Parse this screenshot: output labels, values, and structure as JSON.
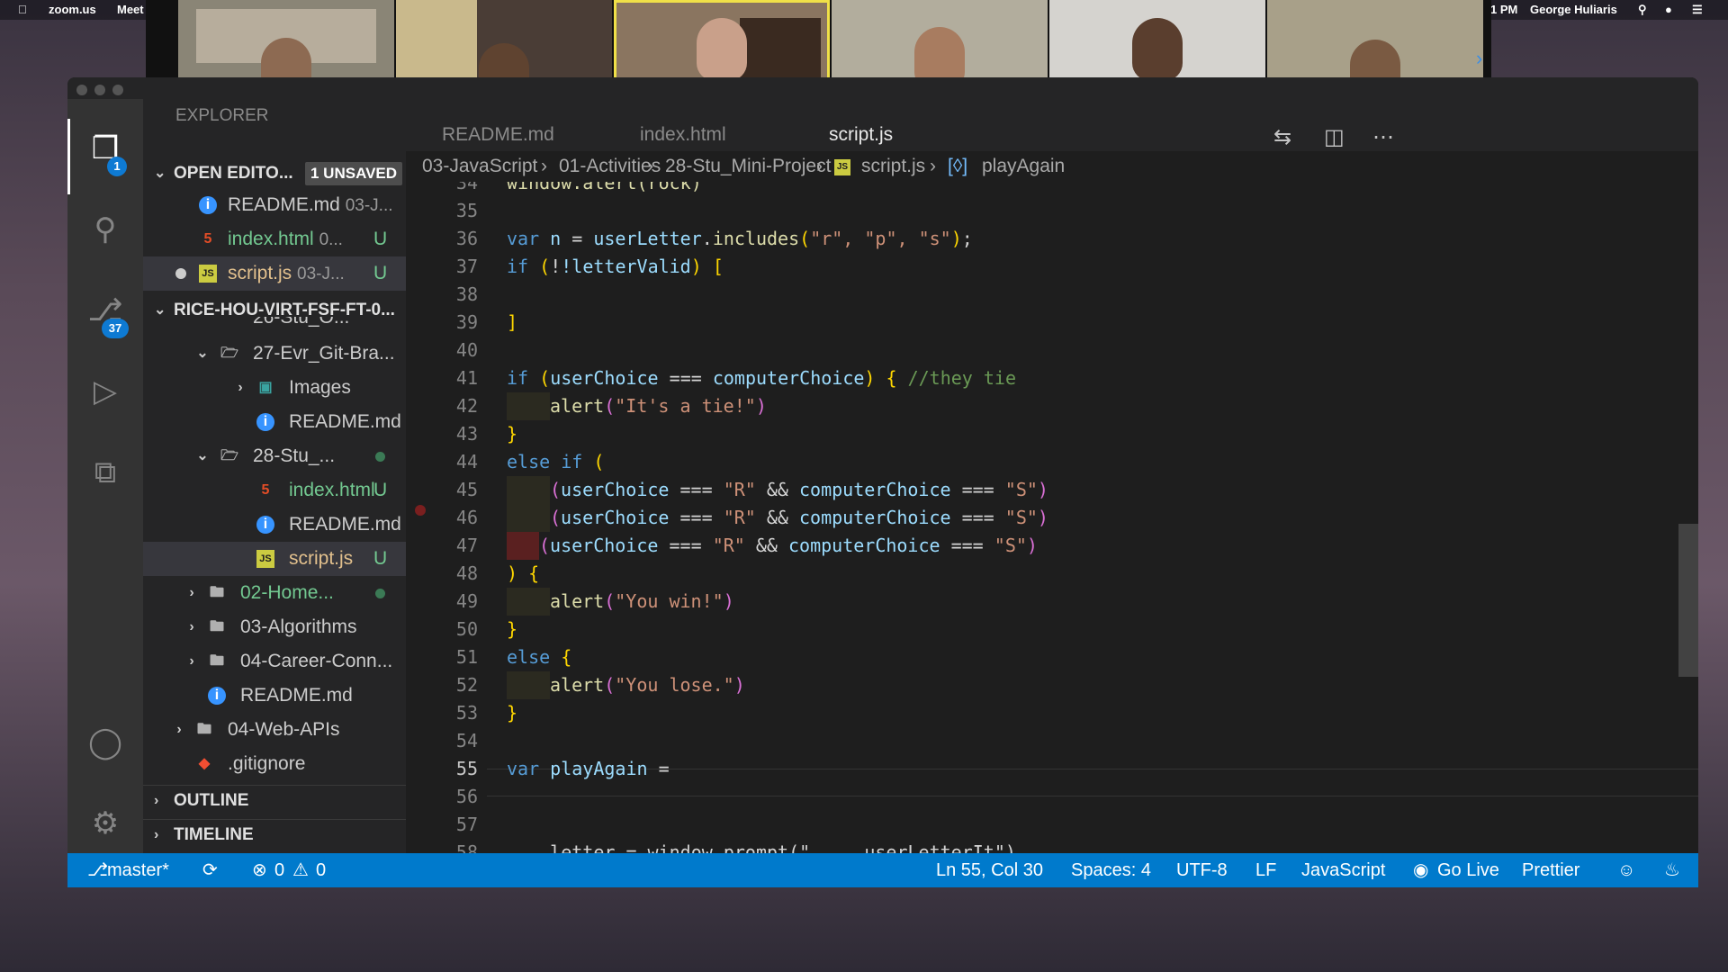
{
  "menubar": {
    "app": "zoom.us",
    "menu_meet": "Meet",
    "time": "1 PM",
    "user": "George Huliaris"
  },
  "zoom": {
    "participants": 6
  },
  "tabs": [
    "README.md",
    "index.html",
    "script.js"
  ],
  "explorer": {
    "header": "EXPLORER",
    "open_editors": {
      "label": "OPEN EDITO...",
      "badge": "1 UNSAVED",
      "items": [
        {
          "name": "README.md",
          "desc": "03-J...",
          "status": ""
        },
        {
          "name": "index.html",
          "desc": "0...",
          "status": "U"
        },
        {
          "name": "script.js",
          "desc": "03-J...",
          "status": "U"
        }
      ]
    },
    "workspace": {
      "label": "RICE-HOU-VIRT-FSF-FT-0...",
      "items": [
        {
          "name": "26-Stu_O..."
        },
        {
          "name": "27-Evr_Git-Bra..."
        },
        {
          "name": "Images"
        },
        {
          "name": "README.md"
        },
        {
          "name": "28-Stu_..."
        },
        {
          "name": "index.html",
          "status": "U"
        },
        {
          "name": "README.md"
        },
        {
          "name": "script.js",
          "status": "U"
        },
        {
          "name": "02-Home..."
        },
        {
          "name": "03-Algorithms"
        },
        {
          "name": "04-Career-Conn..."
        },
        {
          "name": "README.md"
        },
        {
          "name": "04-Web-APIs"
        },
        {
          "name": ".gitignore"
        }
      ]
    },
    "outline": "OUTLINE",
    "timeline": "TIMELINE"
  },
  "activity": {
    "explorer_badge": "1",
    "scm_badge": "37"
  },
  "breadcrumbs": [
    "03-JavaScript",
    "01-Activities",
    "28-Stu_Mini-Project",
    "script.js",
    "playAgain"
  ],
  "code": {
    "line_numbers": [
      "34",
      "35",
      "36",
      "37",
      "38",
      "39",
      "40",
      "41",
      "42",
      "43",
      "44",
      "45",
      "46",
      "47",
      "48",
      "49",
      "50",
      "51",
      "52",
      "53",
      "54",
      "55",
      "56",
      "57",
      "58"
    ],
    "l34": "window.alert(rock)",
    "l36": {
      "kw": "var",
      "name": "n",
      "eq": " = ",
      "obj": "userLetter",
      "method": "includes",
      "args": "\"r\", \"p\", \"s\""
    },
    "l37": {
      "kw": "if",
      "cond": "!letterValid"
    },
    "l41": {
      "kw": "if",
      "a": "userChoice",
      "op": " === ",
      "b": "computerChoice",
      "comment": "//they tie"
    },
    "l42": {
      "fn": "alert",
      "str": "\"It's a tie!\""
    },
    "l44": {
      "kw1": "else",
      "kw2": "if"
    },
    "cmp": {
      "a": "userChoice",
      "op": " === ",
      "r": "\"R\"",
      "and": " && ",
      "b": "computerChoice",
      "s": "\"S\""
    },
    "l49": {
      "fn": "alert",
      "str": "\"You win!\""
    },
    "l51": {
      "kw": "else"
    },
    "l52": {
      "fn": "alert",
      "str": "\"You lose.\""
    },
    "l55": {
      "kw": "var",
      "name": "playAgain",
      "rest": " ="
    },
    "l58": "    letter = window.prompt(\"...  userLetterIt\")"
  },
  "status": {
    "branch": "master*",
    "errors": "0",
    "warnings": "0",
    "position": "Ln 55, Col 30",
    "spaces": "Spaces: 4",
    "encoding": "UTF-8",
    "eol": "LF",
    "language": "JavaScript",
    "golive": "Go Live",
    "prettier": "Prettier"
  },
  "colors": {
    "statusbar": "#007acc",
    "editor_bg": "#1e1e1e",
    "sidebar_bg": "#252526",
    "activity_bg": "#333333"
  }
}
